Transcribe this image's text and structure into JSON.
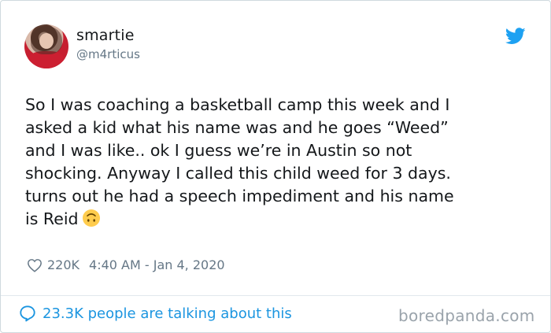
{
  "user": {
    "display_name": "smartie",
    "handle": "@m4rticus"
  },
  "tweet": {
    "lines": [
      "So I was coaching a basketball camp this week and I",
      "asked a kid what his name was and he goes “Weed”",
      "and I was like.. ok I guess we’re in Austin so not",
      "shocking. Anyway I called this child weed for 3 days.",
      "turns out he had a speech impediment and his name",
      "is Reid"
    ],
    "emoji": "upside-down-face-icon"
  },
  "meta": {
    "likes": "220K",
    "timestamp": "4:40 AM - Jan 4, 2020"
  },
  "footer": {
    "talking": "23.3K people are talking about this",
    "watermark": "boredpanda.com"
  },
  "icons": {
    "brand": "twitter-bird-icon",
    "like": "heart-icon",
    "talk": "speech-bubble-icon"
  },
  "colors": {
    "twitter_blue": "#1da1f2",
    "link_blue": "#1b95e0",
    "muted": "#657786",
    "text": "#14171a",
    "emoji_yellow": "#ffcc4d"
  }
}
